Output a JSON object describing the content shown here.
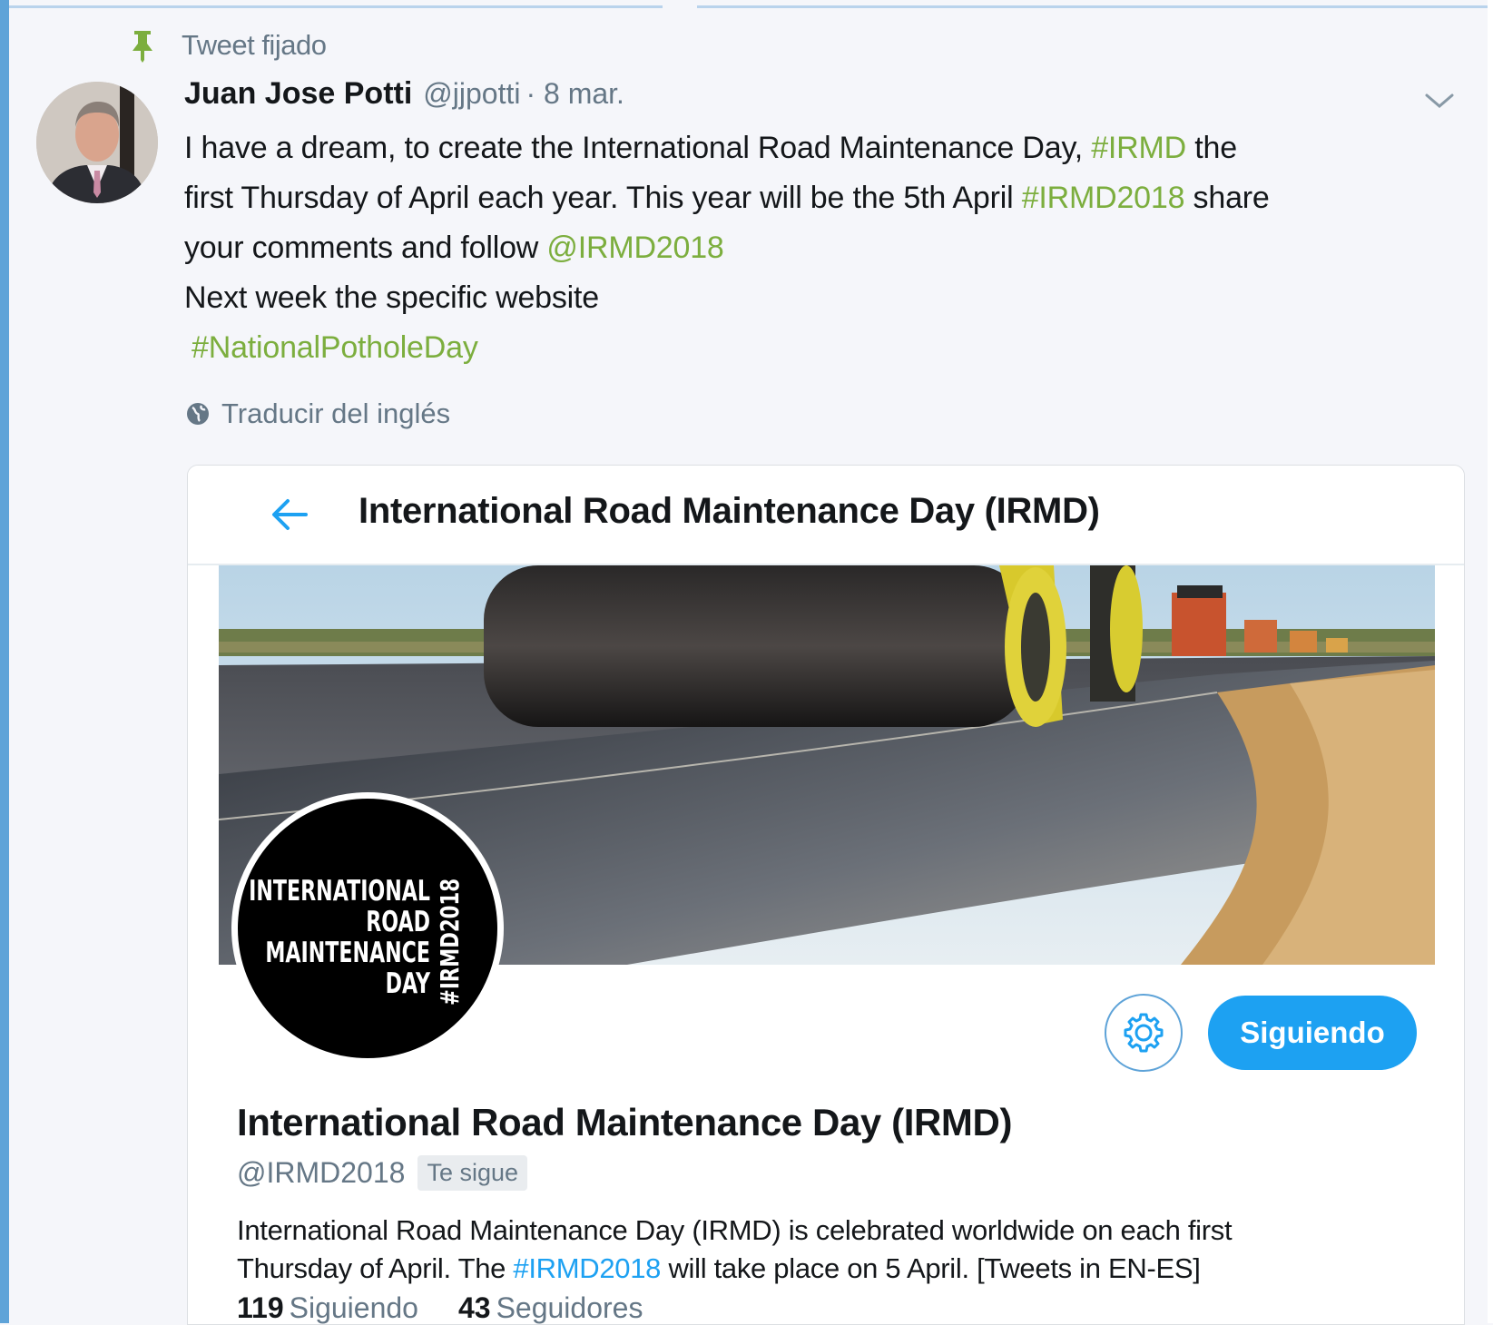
{
  "pinned": {
    "label": "Tweet fijado",
    "icon": "pin-icon"
  },
  "tweet": {
    "author_name": "Juan Jose Potti",
    "author_handle": "@jjpotti",
    "date": "· 8 mar.",
    "text": {
      "line1_a": "I have a dream, to create the International Road Maintenance Day, ",
      "line1_tag": "#IRMD",
      "line1_b": " the",
      "line2_a": "first Thursday of April each year. This year will be the 5th April ",
      "line2_tag": "#IRMD2018",
      "line2_b": " share",
      "line3_a": "your comments and follow ",
      "line3_mention": "@IRMD2018",
      "line4": "Next week the specific website",
      "line5_tag": "#NationalPotholeDay"
    },
    "translate_label": "Traducir del inglés",
    "accent_color": "#7cae3e"
  },
  "card": {
    "header_title": "International Road Maintenance Day (IRMD)",
    "profile": {
      "logo_text": {
        "line1": "INTERNATIONAL",
        "line2": "ROAD",
        "line3": "MAINTENANCE",
        "line4": "DAY",
        "vertical": "#IRMD2018"
      },
      "name": "International Road Maintenance Day (IRMD)",
      "handle": "@IRMD2018",
      "follows_you": "Te sigue",
      "follow_button": "Siguiendo",
      "bio_a": "International Road Maintenance Day (IRMD) is celebrated worldwide on each first",
      "bio_b": "Thursday of April. The ",
      "bio_link": "#IRMD2018",
      "bio_c": " will take place on 5 April. [Tweets in EN-ES]",
      "following_count": "119",
      "following_label": "Siguiendo",
      "followers_count": "43",
      "followers_label": "Seguidores"
    },
    "brand_color": "#1da1f2"
  }
}
